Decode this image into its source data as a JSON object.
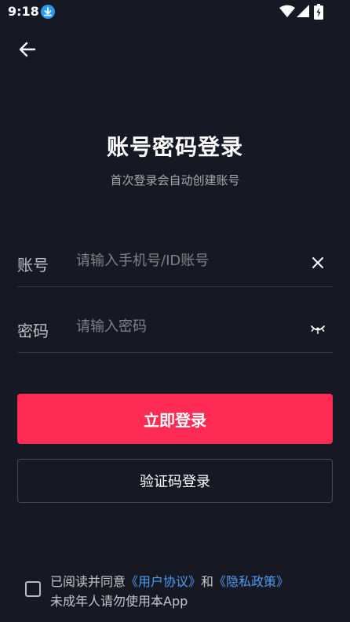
{
  "status_bar": {
    "time": "9:18",
    "icons": [
      "download-icon",
      "wifi-icon",
      "signal-icon",
      "battery-icon"
    ]
  },
  "header": {
    "back_icon": "arrow-left-icon"
  },
  "main": {
    "title": "账号密码登录",
    "subtitle": "首次登录会自动创建账号"
  },
  "form": {
    "account": {
      "label": "账号",
      "placeholder": "请输入手机号/ID账号",
      "value": "",
      "action_icon": "close-icon"
    },
    "password": {
      "label": "密码",
      "placeholder": "请输入密码",
      "value": "",
      "action_icon": "eye-closed-icon"
    }
  },
  "actions": {
    "login_label": "立即登录",
    "code_login_label": "验证码登录"
  },
  "agreement": {
    "prefix": "已阅读并同意",
    "user_agreement": "《用户协议》",
    "and": "和",
    "privacy_policy": "《隐私政策》",
    "line2": "未成年人请勿使用本App",
    "checked": false
  },
  "colors": {
    "background": "#161823",
    "primary": "#fe2c55",
    "link": "#4e9bf2"
  }
}
